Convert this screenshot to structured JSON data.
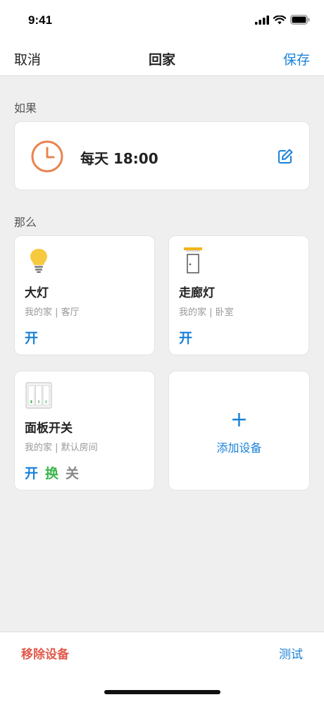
{
  "status_bar": {
    "time": "9:41"
  },
  "nav": {
    "cancel": "取消",
    "title": "回家",
    "save": "保存"
  },
  "if_section": {
    "label": "如果",
    "trigger_text": "每天 18:00"
  },
  "then_section": {
    "label": "那么"
  },
  "devices": [
    {
      "name": "大灯",
      "location": "我的家 | 客厅",
      "actions": [
        "开"
      ]
    },
    {
      "name": "走廊灯",
      "location": "我的家 | 卧室",
      "actions": [
        "开"
      ]
    },
    {
      "name": "面板开关",
      "location": "我的家 | 默认房间",
      "actions": [
        "开",
        "换",
        "关"
      ]
    }
  ],
  "add_device": {
    "icon": "+",
    "label": "添加设备"
  },
  "bottom": {
    "remove": "移除设备",
    "test": "测试"
  },
  "colors": {
    "accent": "#1a82d8",
    "danger": "#e05a4b",
    "clock": "#e8844f",
    "action_on": "#1a82d8",
    "action_toggle": "#3bb54a",
    "action_off": "#888888"
  }
}
